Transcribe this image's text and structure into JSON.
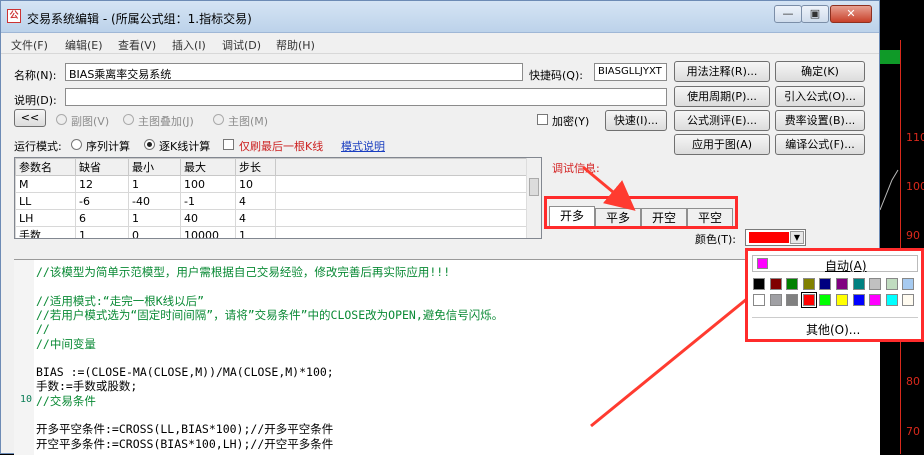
{
  "window": {
    "app_icon_text": "公",
    "title": "交易系统编辑 - (所属公式组：1.指标交易)",
    "caption_buttons": [
      "—",
      "▣",
      "✕"
    ]
  },
  "menu": [
    "文件(F)",
    "编辑(E)",
    "查看(V)",
    "插入(I)",
    "调试(D)",
    "帮助(H)"
  ],
  "form": {
    "name_label": "名称(N):",
    "name_value": "BIAS乘离率交易系统",
    "shortcut_label": "快捷码(Q):",
    "shortcut_value": "BIASGLLJYXT",
    "desc_label": "说明(D):",
    "desc_value": "",
    "collapse_button": "<<",
    "mode_radios": [
      "副图(V)",
      "主图叠加(J)",
      "主图(M)"
    ],
    "encrypt_label": "加密(Y)",
    "fast_button": "快速(I)...",
    "run_mode_label": "运行模式:",
    "run_mode_options": [
      "序列计算",
      "逐K线计算"
    ],
    "last_bar_label": "仅刷最后一根K线",
    "mode_help_link": "模式说明"
  },
  "buttons": {
    "usage": "用法注释(R)...",
    "confirm": "确定(K)",
    "period": "使用周期(P)...",
    "import": "引入公式(O)...",
    "test": "公式测评(E)...",
    "fee": "费率设置(B)...",
    "apply": "应用于图(A)",
    "compile": "编译公式(F)..."
  },
  "params": {
    "headers": [
      "参数名",
      "缺省",
      "最小",
      "最大",
      "步长"
    ],
    "rows": [
      [
        "M",
        "12",
        "1",
        "100",
        "10"
      ],
      [
        "LL",
        "-6",
        "-40",
        "-1",
        "4"
      ],
      [
        "LH",
        "6",
        "1",
        "40",
        "4"
      ],
      [
        "手数",
        "1",
        "0",
        "10000",
        "1"
      ]
    ]
  },
  "debug_label": "调试信息:",
  "tabs": [
    "开多",
    "平多",
    "开空",
    "平空"
  ],
  "color": {
    "label": "颜色(T):",
    "selected_hex": "#ff0000",
    "auto_label": "自动(A)",
    "auto_hex": "#ff00ff",
    "other_label": "其他(O)...",
    "palette_row1": [
      "#000000",
      "#800000",
      "#008000",
      "#808000",
      "#000080",
      "#800080",
      "#008080",
      "#c0c0c0",
      "#c0dcc0",
      "#a6caf0"
    ],
    "palette_row2": [
      "#ffffff",
      "#a0a0a4",
      "#808080",
      "#ff0000",
      "#00ff00",
      "#ffff00",
      "#0000ff",
      "#ff00ff",
      "#00ffff",
      "#fffbf0"
    ]
  },
  "code": [
    {
      "text": "//该模型为简单示范模型，用户需根据自己交易经验，修改完善后再实际应用!!!",
      "cls": "cmt",
      "ln": ""
    },
    {
      "text": "",
      "cls": "",
      "ln": ""
    },
    {
      "text": "//适用模式:“走完一根K线以后”",
      "cls": "cmt",
      "ln": ""
    },
    {
      "text": "//若用户模式选为“固定时间间隔”，请将”交易条件”中的CLOSE改为OPEN,避免信号闪烁。",
      "cls": "cmt",
      "ln": ""
    },
    {
      "text": "//",
      "cls": "cmt",
      "ln": ""
    },
    {
      "text": "//中间变量",
      "cls": "cmt",
      "ln": ""
    },
    {
      "text": "",
      "cls": "",
      "ln": ""
    },
    {
      "text": "BIAS :=(CLOSE-MA(CLOSE,M))/MA(CLOSE,M)*100;",
      "cls": "",
      "ln": ""
    },
    {
      "text": "手数:=手数或股数;",
      "cls": "",
      "ln": ""
    },
    {
      "text": "//交易条件",
      "cls": "cmt",
      "ln": "10"
    },
    {
      "text": "",
      "cls": "",
      "ln": ""
    },
    {
      "text": "开多平空条件:=CROSS(LL,BIAS*100);//开多平空条件",
      "cls": "",
      "ln": ""
    },
    {
      "text": "开空平多条件:=CROSS(BIAS*100,LH);//开空平多条件",
      "cls": "",
      "ln": ""
    }
  ],
  "right_panel": {
    "ticks": [
      "110",
      "100",
      "90",
      "80",
      "70"
    ]
  }
}
